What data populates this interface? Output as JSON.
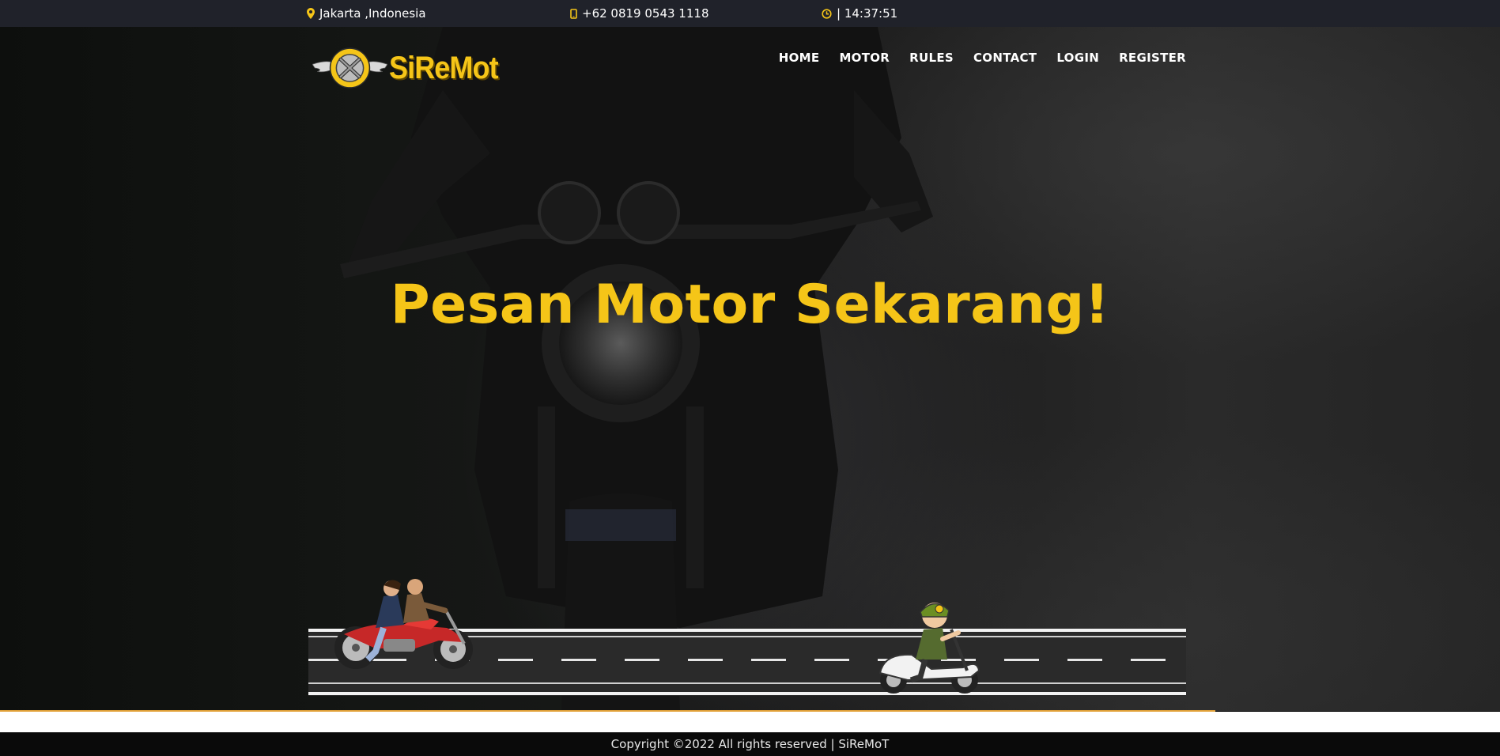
{
  "topbar": {
    "location": "Jakarta ,Indonesia",
    "location_icon": "map-marker-icon",
    "phone": "+62 0819 0543 1118",
    "phone_icon": "mobile-phone-icon",
    "time": "| 14:37:51",
    "time_icon": "clock-icon"
  },
  "logo": {
    "text": "SiReMot"
  },
  "nav": [
    {
      "label": "HOME"
    },
    {
      "label": "MOTOR"
    },
    {
      "label": "RULES"
    },
    {
      "label": "CONTACT"
    },
    {
      "label": "LOGIN"
    },
    {
      "label": "REGISTER"
    }
  ],
  "hero": {
    "headline": "Pesan Motor Sekarang!"
  },
  "footer": {
    "copyright": "Copyright ©2022 All rights reserved | SiReMoT"
  },
  "colors": {
    "accent": "#f5c518",
    "topbar_bg": "#20222a",
    "footer_bg": "#0a0a0a"
  }
}
